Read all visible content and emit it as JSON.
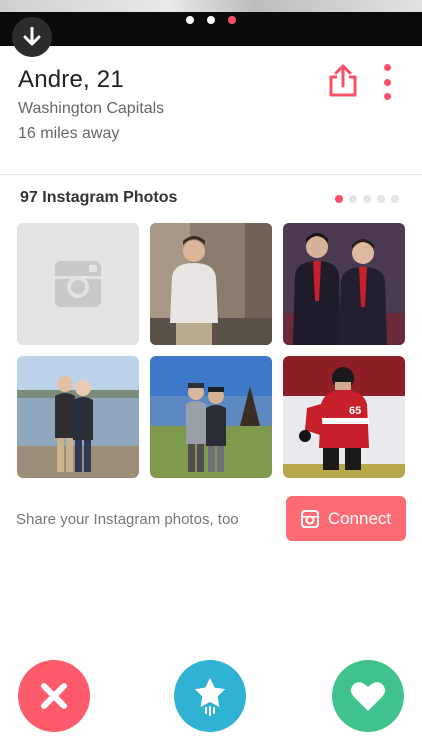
{
  "photo_carousel": {
    "total_photos": 3,
    "active_index": 2
  },
  "profile": {
    "name_age": "Andre, 21",
    "team": "Washington Capitals",
    "distance": "16 miles away"
  },
  "instagram": {
    "title": "97 Instagram Photos",
    "page_count": 5,
    "active_page": 0,
    "tiles": [
      {
        "kind": "placeholder",
        "icon": "instagram-icon"
      },
      {
        "kind": "photo",
        "scene": "man in white sweater indoors"
      },
      {
        "kind": "photo",
        "scene": "two men in suits with red ties"
      },
      {
        "kind": "photo",
        "scene": "two men by the water"
      },
      {
        "kind": "photo",
        "scene": "two men on a golf course"
      },
      {
        "kind": "photo",
        "scene": "hockey player in red jersey 65"
      }
    ],
    "connect_prompt": "Share your Instagram photos, too",
    "connect_label": "Connect"
  },
  "actions": {
    "nope_icon": "close-icon",
    "superlike_icon": "star-icon",
    "like_icon": "heart-icon"
  },
  "colors": {
    "accent": "#fd5068",
    "nope": "#fd5b6b",
    "superlike": "#2fb2d3",
    "like": "#3fc28e"
  }
}
